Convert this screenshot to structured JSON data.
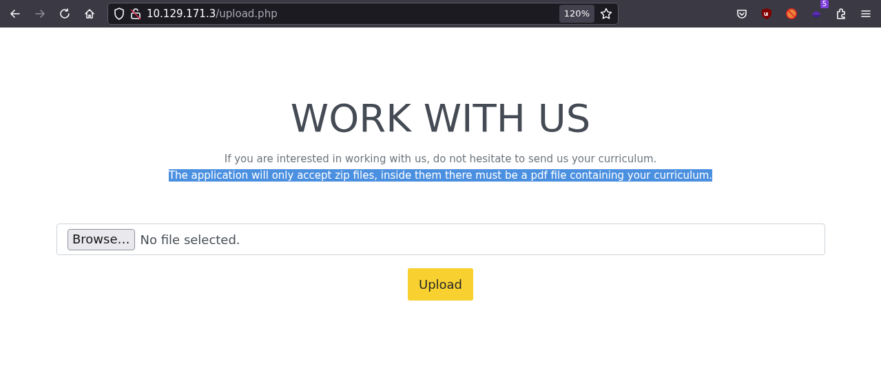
{
  "browser": {
    "url_host": "10.129.171.3",
    "url_path": "/upload.php",
    "zoom": "120%",
    "extension_badge": "5"
  },
  "page": {
    "heading": "WORK WITH US",
    "paragraphs": [
      {
        "text": "If you are interested in working with us, do not hesitate to send us your curriculum.",
        "highlighted": false
      },
      {
        "text": "The application will only accept zip files, inside them there must be a pdf file containing your curriculum.",
        "highlighted": true
      }
    ],
    "file_input": {
      "button": "Browse…",
      "status": "No file selected."
    },
    "submit": "Upload"
  }
}
